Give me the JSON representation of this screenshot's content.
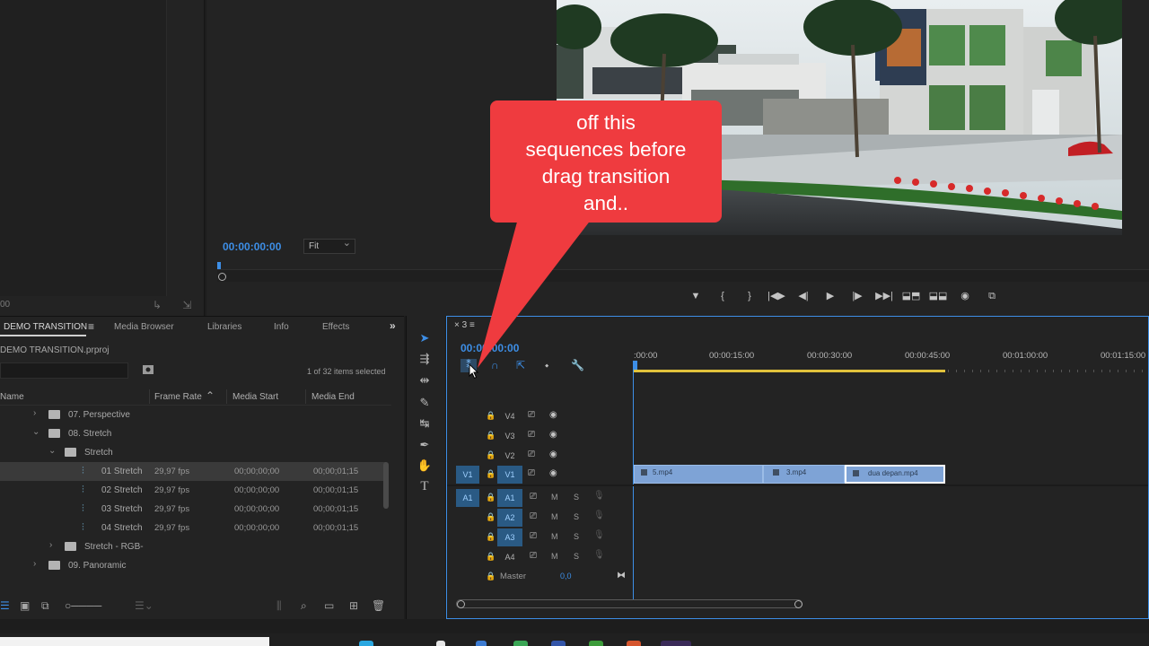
{
  "source_monitor": {
    "timecode": "00",
    "icons": "↳ ⇲"
  },
  "program_monitor": {
    "timecode": "00:00:00:00",
    "fit_label": "Fit",
    "transport": [
      "▼",
      "{",
      "}",
      "|◀▶",
      "◀|",
      "▶",
      "|▶",
      "▶▶|",
      "⬓⬒",
      "⬓⬓",
      "◉",
      "⧉"
    ]
  },
  "callout": {
    "lines": [
      "off this",
      "sequences before",
      "drag transition",
      "and.."
    ],
    "color": "#ef3b3f"
  },
  "project_panel": {
    "tabs": {
      "project": "DEMO TRANSITION",
      "media_browser": "Media Browser",
      "libraries": "Libraries",
      "info": "Info",
      "effects": "Effects"
    },
    "file_name": "DEMO TRANSITION.prproj",
    "items_selected": "1 of 32 items selected",
    "columns": {
      "name": "Name",
      "frame_rate": "Frame Rate",
      "media_start": "Media Start",
      "media_end": "Media End"
    },
    "rows": [
      {
        "name": "07. Perspective",
        "type": "folder",
        "fps": "",
        "start": "",
        "end": ""
      },
      {
        "name": "08. Stretch",
        "type": "folder",
        "fps": "",
        "start": "",
        "end": ""
      },
      {
        "name": "Stretch",
        "type": "folder",
        "fps": "",
        "start": "",
        "end": ""
      },
      {
        "name": "01 Stretch",
        "type": "sequence",
        "fps": "29,97 fps",
        "start": "00;00;00;00",
        "end": "00;00;01;15"
      },
      {
        "name": "02 Stretch",
        "type": "sequence",
        "fps": "29,97 fps",
        "start": "00;00;00;00",
        "end": "00;00;01;15"
      },
      {
        "name": "03 Stretch",
        "type": "sequence",
        "fps": "29,97 fps",
        "start": "00;00;00;00",
        "end": "00;00;01;15"
      },
      {
        "name": "04 Stretch",
        "type": "sequence",
        "fps": "29,97 fps",
        "start": "00;00;00;00",
        "end": "00;00;01;15"
      },
      {
        "name": "Stretch - RGB-",
        "type": "folder",
        "fps": "",
        "start": "",
        "end": ""
      },
      {
        "name": "09. Panoramic",
        "type": "folder",
        "fps": "",
        "start": "",
        "end": ""
      }
    ]
  },
  "tools": [
    "selection-tool",
    "track-select-tool",
    "ripple-edit-tool",
    "razor-tool",
    "slip-tool",
    "pen-tool",
    "hand-tool",
    "type-tool"
  ],
  "timeline": {
    "tab_label": "3",
    "timecode": "00:00:00:00",
    "ruler": [
      ":00:00",
      "00:00:15:00",
      "00:00:30:00",
      "00:00:45:00",
      "00:01:00:00",
      "00:01:15:00"
    ],
    "video_tracks": [
      {
        "name": "V4",
        "src": ""
      },
      {
        "name": "V3",
        "src": ""
      },
      {
        "name": "V2",
        "src": ""
      },
      {
        "name": "V1",
        "src": "V1"
      }
    ],
    "audio_tracks": [
      {
        "name": "A1",
        "src": "A1"
      },
      {
        "name": "A2",
        "src": ""
      },
      {
        "name": "A3",
        "src": ""
      },
      {
        "name": "A4",
        "src": ""
      }
    ],
    "track_m": "M",
    "track_s": "S",
    "master": {
      "label": "Master",
      "value": "0,0"
    },
    "clips": [
      {
        "name": "5.mp4"
      },
      {
        "name": "3.mp4"
      },
      {
        "name": "dua depan.mp4"
      }
    ]
  },
  "colors": {
    "accent_blue": "#3d8ee6",
    "clip_blue": "#7ea3d6",
    "work_area_yellow": "#e1c23b"
  }
}
